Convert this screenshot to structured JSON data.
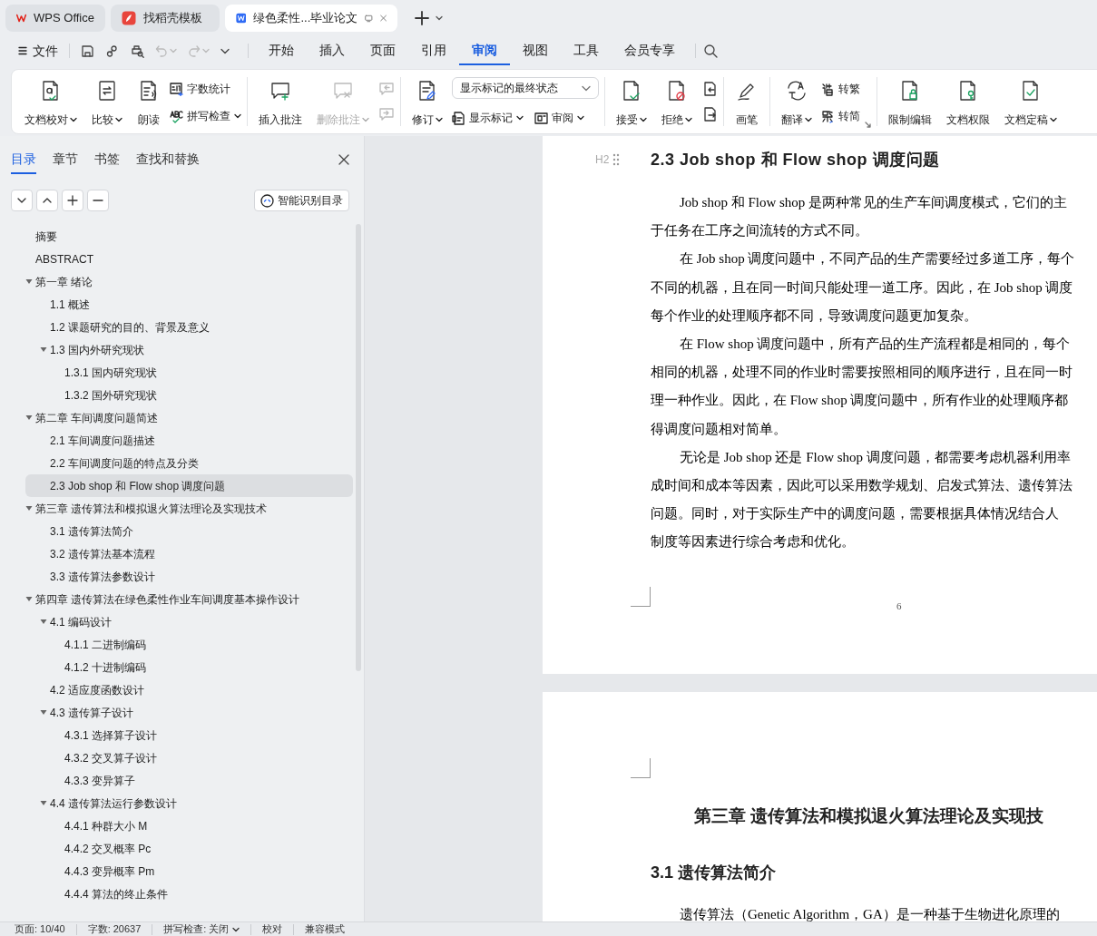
{
  "title_tabs": [
    {
      "label": "WPS Office",
      "selected": false
    },
    {
      "label": "找稻壳模板",
      "selected": false
    },
    {
      "label": "绿色柔性...毕业论文",
      "selected": true
    }
  ],
  "menu": {
    "file": "文件",
    "tabs": [
      {
        "label": "开始",
        "selected": false
      },
      {
        "label": "插入",
        "selected": false
      },
      {
        "label": "页面",
        "selected": false
      },
      {
        "label": "引用",
        "selected": false
      },
      {
        "label": "审阅",
        "selected": true
      },
      {
        "label": "视图",
        "selected": false
      },
      {
        "label": "工具",
        "selected": false
      },
      {
        "label": "会员专享",
        "selected": false
      }
    ]
  },
  "ribbon": {
    "groups": [
      {
        "items": [
          {
            "kind": "large",
            "label": "文档校对",
            "dropdown": true
          },
          {
            "kind": "large",
            "label": "比较",
            "dropdown": true
          },
          {
            "kind": "large",
            "label": "朗读",
            "dropdown": false
          },
          {
            "kind": "stack",
            "rows": [
              {
                "label": "字数统计",
                "dropdown": false
              },
              {
                "label": "拼写检查",
                "dropdown": true
              }
            ]
          }
        ]
      },
      {
        "items": [
          {
            "kind": "large",
            "label": "插入批注",
            "dropdown": false,
            "disabled": false
          },
          {
            "kind": "large",
            "label": "删除批注",
            "dropdown": true,
            "disabled": true
          },
          {
            "kind": "iconstack"
          }
        ]
      },
      {
        "items": [
          {
            "kind": "large",
            "label": "修订",
            "dropdown": true
          },
          {
            "kind": "select",
            "value": "显示标记的最终状态",
            "rows": [
              {
                "label": "显示标记",
                "dropdown": true
              },
              {
                "label": "审阅",
                "dropdown": true
              }
            ]
          }
        ]
      },
      {
        "items": [
          {
            "kind": "large",
            "label": "接受",
            "dropdown": true
          },
          {
            "kind": "large",
            "label": "拒绝",
            "dropdown": true
          },
          {
            "kind": "iconstack"
          }
        ]
      },
      {
        "items": [
          {
            "kind": "large",
            "label": "画笔",
            "dropdown": false
          }
        ]
      },
      {
        "items": [
          {
            "kind": "large",
            "label": "翻译",
            "dropdown": true
          },
          {
            "kind": "stack",
            "rows": [
              {
                "label": "转繁",
                "dropdown": false
              },
              {
                "label": "转简",
                "dropdown": false
              }
            ]
          }
        ]
      },
      {
        "items": [
          {
            "kind": "large",
            "label": "限制编辑",
            "dropdown": false
          },
          {
            "kind": "large",
            "label": "文档权限",
            "dropdown": false
          },
          {
            "kind": "large",
            "label": "文档定稿",
            "dropdown": true
          }
        ]
      }
    ]
  },
  "nav_panel": {
    "tabs": [
      {
        "label": "目录",
        "selected": true
      },
      {
        "label": "章节",
        "selected": false
      },
      {
        "label": "书签",
        "selected": false
      },
      {
        "label": "查找和替换",
        "selected": false
      }
    ],
    "smart_button": "智能识别目录",
    "outline": [
      {
        "label": "摘要",
        "selected": false
      },
      {
        "label": "ABSTRACT",
        "selected": false
      },
      {
        "label": "第一章  绪论",
        "selected": false,
        "expanded": true,
        "children": [
          {
            "label": "1.1  概述",
            "selected": false
          },
          {
            "label": "1.2  课题研究的目的、背景及意义",
            "selected": false
          },
          {
            "label": "1.3  国内外研究现状",
            "selected": false,
            "expanded": true,
            "children": [
              {
                "label": "1.3.1 国内研究现状",
                "selected": false
              },
              {
                "label": "1.3.2 国外研究现状",
                "selected": false
              }
            ]
          }
        ]
      },
      {
        "label": "第二章  车间调度问题简述",
        "selected": false,
        "expanded": true,
        "children": [
          {
            "label": "2.1  车间调度问题描述",
            "selected": false
          },
          {
            "label": "2.2  车间调度问题的特点及分类",
            "selected": false
          },
          {
            "label": "2.3 Job shop 和 Flow shop 调度问题",
            "selected": true
          }
        ]
      },
      {
        "label": "第三章  遗传算法和模拟退火算法理论及实现技术",
        "selected": false,
        "expanded": true,
        "children": [
          {
            "label": "3.1  遗传算法简介",
            "selected": false
          },
          {
            "label": "3.2  遗传算法基本流程",
            "selected": false
          },
          {
            "label": "3.3  遗传算法参数设计",
            "selected": false
          }
        ]
      },
      {
        "label": "第四章  遗传算法在绿色柔性作业车间调度基本操作设计",
        "selected": false,
        "expanded": true,
        "children": [
          {
            "label": "4.1  编码设计",
            "selected": false,
            "expanded": true,
            "children": [
              {
                "label": "4.1.1 二进制编码",
                "selected": false
              },
              {
                "label": "4.1.2 十进制编码",
                "selected": false
              }
            ]
          },
          {
            "label": "4.2 适应度函数设计",
            "selected": false
          },
          {
            "label": "4.3 遗传算子设计",
            "selected": false,
            "expanded": true,
            "children": [
              {
                "label": "4.3.1 选择算子设计",
                "selected": false
              },
              {
                "label": "4.3.2  交叉算子设计",
                "selected": false
              },
              {
                "label": "4.3.3 变异算子",
                "selected": false
              }
            ]
          },
          {
            "label": "4.4 遗传算法运行参数设计",
            "selected": false,
            "expanded": true,
            "children": [
              {
                "label": "4.4.1 种群大小 M",
                "selected": false
              },
              {
                "label": "4.4.2 交叉概率 Pc",
                "selected": false
              },
              {
                "label": "4.4.3 变异概率 Pm",
                "selected": false
              },
              {
                "label": "4.4.4 算法的终止条件",
                "selected": false
              }
            ]
          }
        ]
      }
    ]
  },
  "document": {
    "page_1": {
      "heading_marker": "H2",
      "heading": "2.3 Job shop 和 Flow shop 调度问题",
      "paragraphs": [
        [
          "Job shop 和 Flow shop 是两种常见的生产车间调度模式，它们的主",
          "于任务在工序之间流转的方式不同。"
        ],
        [
          "在 Job shop 调度问题中，不同产品的生产需要经过多道工序，每个",
          "不同的机器，且在同一时间只能处理一道工序。因此，在 Job shop 调度",
          "每个作业的处理顺序都不同，导致调度问题更加复杂。"
        ],
        [
          "在 Flow shop 调度问题中，所有产品的生产流程都是相同的，每个",
          "相同的机器，处理不同的作业时需要按照相同的顺序进行，且在同一时",
          "理一种作业。因此，在 Flow shop 调度问题中，所有作业的处理顺序都",
          "得调度问题相对简单。"
        ],
        [
          "无论是 Job shop 还是 Flow shop 调度问题，都需要考虑机器利用率",
          "成时间和成本等因素，因此可以采用数学规划、启发式算法、遗传算法",
          "问题。同时，对于实际生产中的调度问题，需要根据具体情况结合人",
          "制度等因素进行综合考虑和优化。"
        ]
      ],
      "page_number": "6"
    },
    "page_2": {
      "chapter_heading": "第三章  遗传算法和模拟退火算法理论及实现技",
      "section_heading": "3.1  遗传算法简介",
      "paragraph_start": "遗传算法（Genetic Algorithm，GA）是一种基于生物进化原理的"
    }
  },
  "status_bar": [
    {
      "kind": "text",
      "label": "页面: 10/40"
    },
    {
      "kind": "text",
      "label": "字数: 20637"
    },
    {
      "kind": "dropdown",
      "label": "拼写检查: 关闭"
    },
    {
      "kind": "text",
      "label": "校对"
    },
    {
      "kind": "text",
      "label": "兼容模式"
    }
  ]
}
